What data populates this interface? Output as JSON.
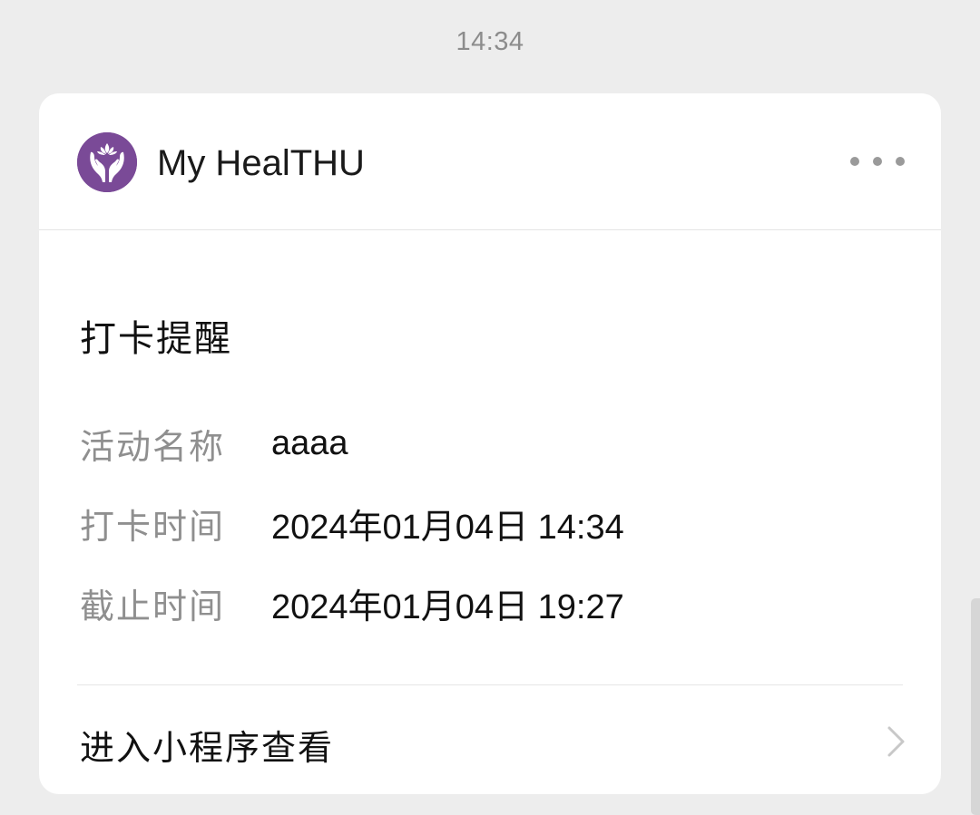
{
  "chat": {
    "timestamp": "14:34"
  },
  "card": {
    "app_name": "My HealTHU",
    "avatar_icon": "hands-lotus-icon",
    "avatar_color": "#7a4a97",
    "more_icon": "more-dots-icon",
    "title": "打卡提醒",
    "rows": [
      {
        "label": "活动名称",
        "value": "aaaa"
      },
      {
        "label": "打卡时间",
        "value": "2024年01月04日 14:34"
      },
      {
        "label": "截止时间",
        "value": "2024年01月04日 19:27"
      }
    ],
    "footer_link": "进入小程序查看",
    "footer_icon": "chevron-right-icon"
  }
}
